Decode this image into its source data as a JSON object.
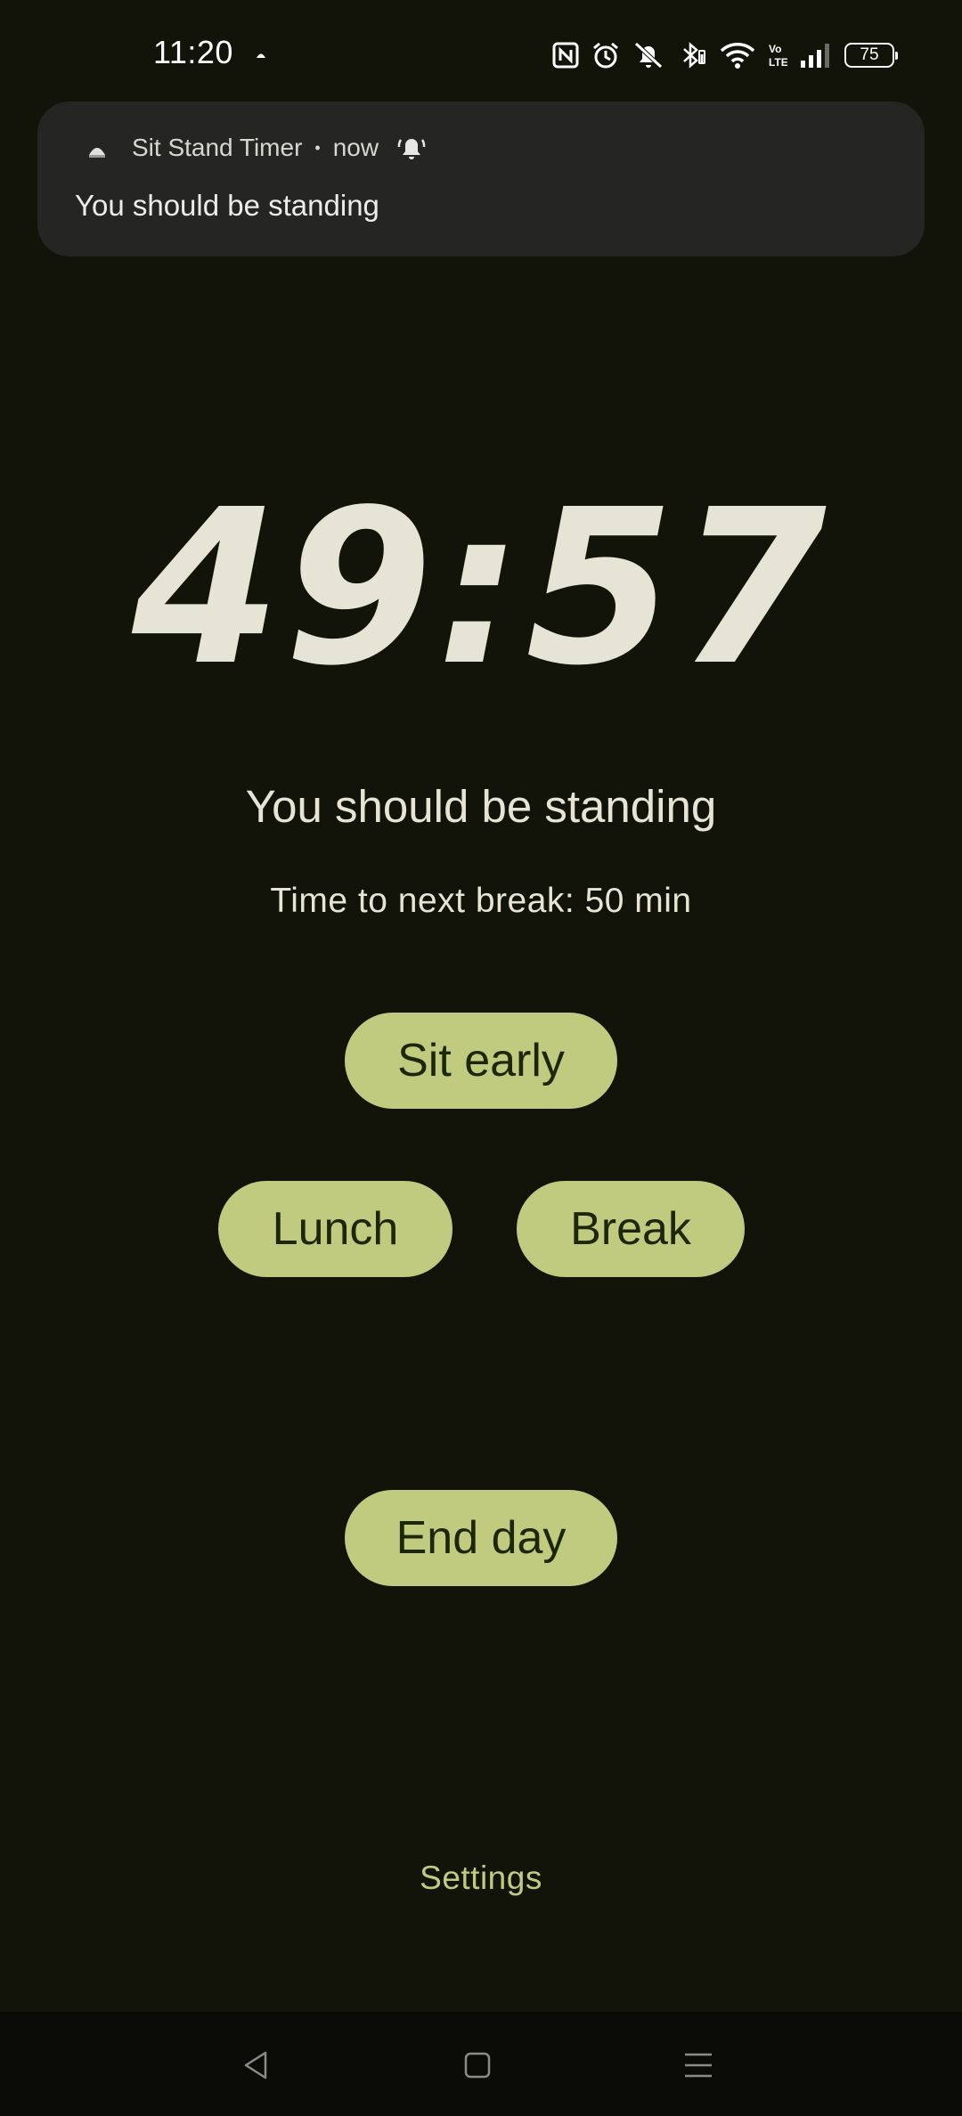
{
  "status_bar": {
    "time": "11:20",
    "battery_level": "75",
    "icons": [
      "nfc-icon",
      "alarm-icon",
      "mute-icon",
      "bluetooth-icon",
      "wifi-icon",
      "volte-icon",
      "signal-icon",
      "battery-icon"
    ]
  },
  "notification": {
    "app_name": "Sit Stand Timer",
    "separator": "•",
    "time": "now",
    "message": "You should be standing",
    "icons": [
      "app-icon",
      "alert-bell-icon"
    ]
  },
  "timer": {
    "value": "49:57"
  },
  "state": {
    "message": "You should be standing",
    "next_break": "Time to next break: 50 min"
  },
  "buttons": {
    "sit_early": "Sit early",
    "lunch": "Lunch",
    "break": "Break",
    "end_day": "End day"
  },
  "settings_label": "Settings",
  "nav_bar": {
    "icons": [
      "back-icon",
      "home-icon",
      "recents-icon"
    ]
  },
  "colors": {
    "background": "#121409",
    "accent": "#c0cb80",
    "accent_text": "#1d2608",
    "text": "#e6e4d4",
    "notification_bg": "#252624"
  }
}
